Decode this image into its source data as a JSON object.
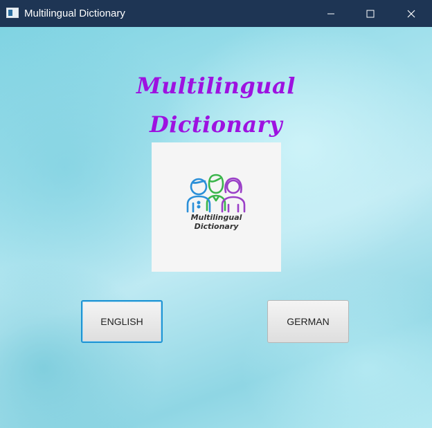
{
  "window": {
    "title": "Multilingual Dictionary",
    "controls": [
      "minimize",
      "maximize",
      "close"
    ]
  },
  "main": {
    "heading_line1": "Multilingual",
    "heading_line2": "Dictionary",
    "logo": {
      "line1": "Multilingual",
      "line2": "Dictionary",
      "icon": "people-group-icon"
    },
    "buttons": {
      "english": "ENGLISH",
      "german": "GERMAN"
    }
  },
  "colors": {
    "titlebar": "#1e3554",
    "heading": "#9d12e0",
    "focus_border": "#1f94d4",
    "person_blue": "#2a8fd8",
    "person_green": "#3ab54a",
    "person_purple": "#9a3fc7"
  }
}
